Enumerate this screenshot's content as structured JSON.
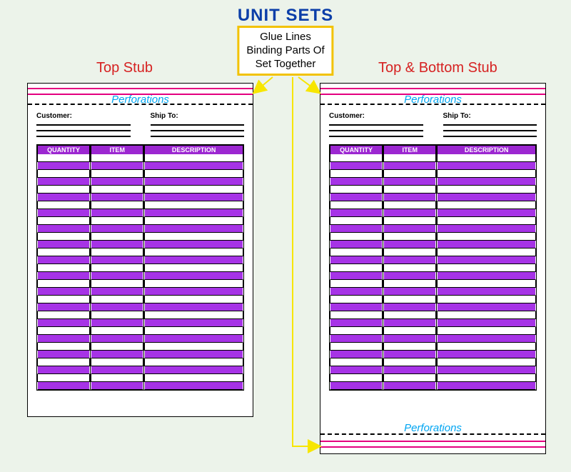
{
  "title": "UNIT SETS",
  "callout": {
    "line1": "Glue Lines",
    "line2": "Binding Parts Of",
    "line3": "Set Together"
  },
  "labels": {
    "left": "Top Stub",
    "right": "Top & Bottom Stub"
  },
  "perforations_label": "Perforations",
  "form": {
    "customer_label": "Customer:",
    "shipto_label": "Ship To:",
    "columns": {
      "quantity": "QUANTITY",
      "item": "ITEM",
      "description": "DESCRIPTION"
    },
    "row_count": 30
  },
  "colors": {
    "title": "#0b3ea8",
    "callout_border": "#f2c200",
    "label": "#d62222",
    "glue_line": "#e4007f",
    "perforation_text": "#00a5f2",
    "table_header": "#9c27d1",
    "table_stripe": "#a633e6",
    "arrow": "#f7e600"
  }
}
